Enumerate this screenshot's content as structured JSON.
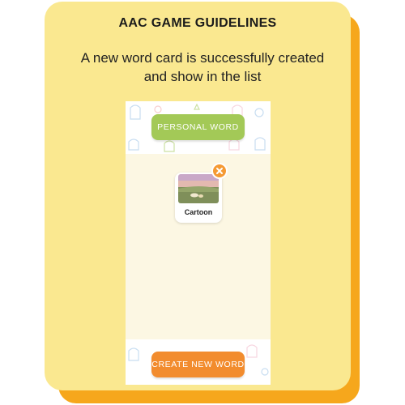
{
  "header": {
    "title": "AAC GAME GUIDELINES",
    "subtitle": "A new word card is successfully created and show in the list"
  },
  "screen": {
    "personal_word_label": "PERSONAL WORD",
    "create_new_word_label": "CREATE NEW WORD",
    "word_cards": [
      {
        "label": "Cartoon",
        "image": "cartoon-landscape-thumbnail"
      }
    ],
    "delete_icon": "close-icon"
  },
  "colors": {
    "card_background": "#fae890",
    "card_shadow": "#f6a71c",
    "personal_word_button": "#a3c957",
    "create_word_button": "#f28c2e",
    "delete_badge": "#f59a33"
  }
}
